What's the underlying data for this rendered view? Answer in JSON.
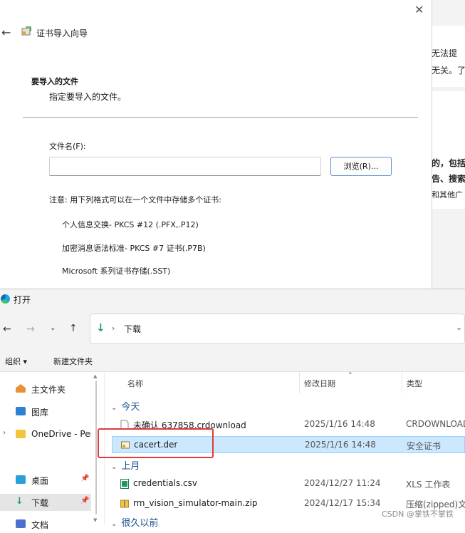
{
  "background_page": {
    "lines": [
      "无法提",
      "无关。了解",
      "的，包括",
      "告、搜索",
      "和其他广"
    ]
  },
  "wizard": {
    "title": "证书导入向导",
    "section_title": "要导入的文件",
    "section_subtitle": "指定要导入的文件。",
    "file_label": "文件名(F):",
    "file_value": "",
    "browse_label": "浏览(R)...",
    "note": "注意: 用下列格式可以在一个文件中存储多个证书:",
    "formats": [
      "个人信息交换- PKCS #12 (.PFX,.P12)",
      "加密消息语法标准- PKCS #7 证书(.P7B)",
      "Microsoft 系列证书存储(.SST)"
    ]
  },
  "dialog": {
    "title": "打开",
    "address": "下载",
    "commands": {
      "organize": "组织 ▾",
      "new_folder": "新建文件夹"
    },
    "nav_items": [
      {
        "label": "主文件夹",
        "icon": "home-icon"
      },
      {
        "label": "图库",
        "icon": "gallery-icon"
      },
      {
        "label": "OneDrive - Personal",
        "icon": "folder-icon"
      },
      {
        "label": "桌面",
        "icon": "desktop-icon"
      },
      {
        "label": "下载",
        "icon": "download-icon"
      },
      {
        "label": "文档",
        "icon": "document-icon"
      }
    ],
    "columns": {
      "name": "名称",
      "modified": "修改日期",
      "type": "类型"
    },
    "groups": [
      {
        "label": "今天"
      },
      {
        "label": "上月"
      },
      {
        "label": "很久以前"
      }
    ],
    "files": [
      {
        "name": "未确认 637858.crdownload",
        "date": "2025/1/16 14:48",
        "type": "CRDOWNLOAD"
      },
      {
        "name": "cacert.der",
        "date": "2025/1/16 14:48",
        "type": "安全证书"
      },
      {
        "name": "credentials.csv",
        "date": "2024/12/27 11:24",
        "type": "XLS 工作表"
      },
      {
        "name": "rm_vision_simulator-main.zip",
        "date": "2024/12/17 15:34",
        "type": "压缩(zipped)文件夹"
      }
    ]
  },
  "watermark": "CSDN @掌铁不掌铁"
}
